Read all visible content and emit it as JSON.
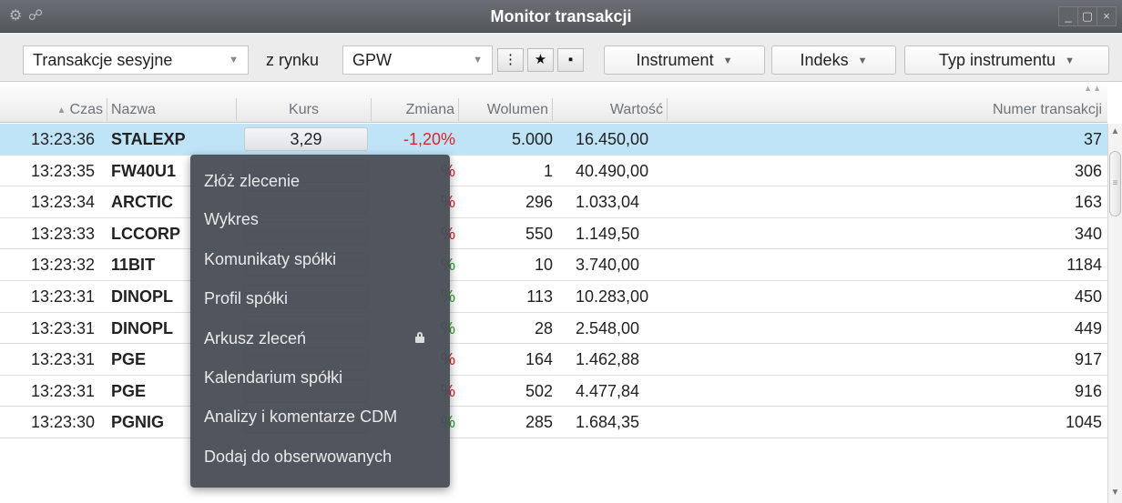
{
  "window": {
    "title": "Monitor transakcji",
    "left_icons": [
      "gear-icon",
      "link-icon"
    ],
    "controls": [
      "minimize",
      "maximize",
      "close"
    ]
  },
  "toolbar": {
    "session_select": "Transakcje sesyjne",
    "market_label": "z rynku",
    "market_select": "GPW",
    "view_buttons": [
      "more-vertical-icon",
      "star-icon",
      "windows-icon"
    ],
    "instrument_filter": "Instrument",
    "index_filter": "Indeks",
    "type_filter": "Typ instrumentu"
  },
  "table": {
    "columns": [
      "Czas",
      "Nazwa",
      "Kurs",
      "Zmiana",
      "Wolumen",
      "Wartość",
      "Numer transakcji"
    ],
    "rows": [
      {
        "time": "13:23:36",
        "name": "STALEXP",
        "kurs": "3,29",
        "zmiana": "-1,20%",
        "wolumen": "5.000",
        "wartosc": "16.450,00",
        "numer": "37",
        "change_sign": "neg"
      },
      {
        "time": "13:23:35",
        "name": "FW40U1",
        "kurs": "",
        "zmiana": "%",
        "wolumen": "1",
        "wartosc": "40.490,00",
        "numer": "306",
        "change_sign": "neg"
      },
      {
        "time": "13:23:34",
        "name": "ARCTIC",
        "kurs": "",
        "zmiana": "%",
        "wolumen": "296",
        "wartosc": "1.033,04",
        "numer": "163",
        "change_sign": "neg"
      },
      {
        "time": "13:23:33",
        "name": "LCCORP",
        "kurs": "",
        "zmiana": "%",
        "wolumen": "550",
        "wartosc": "1.149,50",
        "numer": "340",
        "change_sign": "neg"
      },
      {
        "time": "13:23:32",
        "name": "11BIT",
        "kurs": "",
        "zmiana": "%",
        "wolumen": "10",
        "wartosc": "3.740,00",
        "numer": "1184",
        "change_sign": "pos"
      },
      {
        "time": "13:23:31",
        "name": "DINOPL",
        "kurs": "",
        "zmiana": "%",
        "wolumen": "113",
        "wartosc": "10.283,00",
        "numer": "450",
        "change_sign": "pos"
      },
      {
        "time": "13:23:31",
        "name": "DINOPL",
        "kurs": "",
        "zmiana": "%",
        "wolumen": "28",
        "wartosc": "2.548,00",
        "numer": "449",
        "change_sign": "pos"
      },
      {
        "time": "13:23:31",
        "name": "PGE",
        "kurs": "",
        "zmiana": "%",
        "wolumen": "164",
        "wartosc": "1.462,88",
        "numer": "917",
        "change_sign": "neg"
      },
      {
        "time": "13:23:31",
        "name": "PGE",
        "kurs": "",
        "zmiana": "%",
        "wolumen": "502",
        "wartosc": "4.477,84",
        "numer": "916",
        "change_sign": "neg"
      },
      {
        "time": "13:23:30",
        "name": "PGNIG",
        "kurs": "",
        "zmiana": "%",
        "wolumen": "285",
        "wartosc": "1.684,35",
        "numer": "1045",
        "change_sign": "pos"
      }
    ]
  },
  "context_menu": {
    "items": [
      "Złóż zlecenie",
      "Wykres",
      "Komunikaty spółki",
      "Profil spółki",
      "Arkusz zleceń",
      "Kalendarium spółki",
      "Analizy i komentarze CDM",
      "Dodaj do obserwowanych"
    ],
    "locked_item_icon": "lock-icon"
  },
  "colors": {
    "negative": "#e0202a",
    "positive": "#23a623",
    "selected_row": "#bfe4f7",
    "titlebar": "#5d6065"
  }
}
